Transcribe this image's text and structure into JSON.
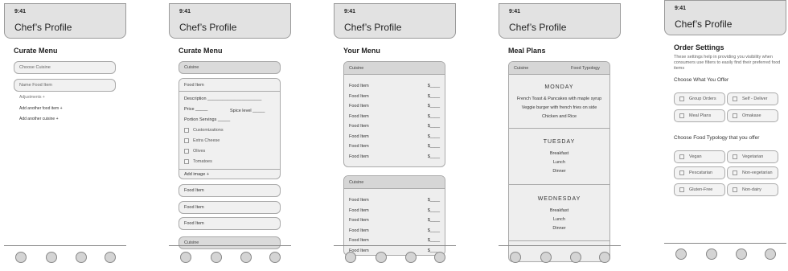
{
  "app": {
    "time": "9:41",
    "title": "Chef’s Profile"
  },
  "screen1": {
    "heading": "Curate Menu",
    "cuisine_placeholder": "Choose Cuisine",
    "food_placeholder": "Name Food Item",
    "adjustments": "Adjustments +",
    "add_food": "Add another food item +",
    "add_cuisine": "Add another cuisine +"
  },
  "screen2": {
    "heading": "Curate Menu",
    "cuisine_label": "Cuisine",
    "food_item_label": "Food Item",
    "description": "Description ______________________",
    "price": "Price _____",
    "spice": "Spice level _____",
    "portion": "Portion Servings _____",
    "options": [
      "Customizations",
      "Extra Cheese",
      "Olives",
      "Tomatoes"
    ],
    "add_image": "Add image +",
    "more_items": [
      "Food Item",
      "Food Item",
      "Food Item"
    ],
    "cuisine_bottom": "Cuisine"
  },
  "screen3": {
    "heading": "Your Menu",
    "card1_head": "Cuisine",
    "card2_head": "Cuisine",
    "item_label": "Food Item",
    "price_label": "$____"
  },
  "screen4": {
    "heading": "Meal Plans",
    "cuisine": "Cuisine",
    "typology": "Food Typology",
    "days": [
      {
        "name": "MONDAY",
        "meals": [
          "French Toast & Pancakes with maple syrup",
          "Veggie burger with french fries on side",
          "Chicken and Rice"
        ]
      },
      {
        "name": "TUESDAY",
        "meals": [
          "Breakfast",
          "Lunch",
          "Dinner"
        ]
      },
      {
        "name": "WEDNESDAY",
        "meals": [
          "Breakfast",
          "Lunch",
          "Dinner"
        ]
      }
    ]
  },
  "screen5": {
    "heading": "Order Settings",
    "description": "These settings help in providing you visibility when consumers use filters to easily find their preferred food items",
    "offer_heading": "Choose What You Offer",
    "offer_options": [
      "Group Orders",
      "Self - Deliver",
      "Meal Plans",
      "Omakase"
    ],
    "typology_heading": "Choose Food Typology that you offer",
    "typology_options": [
      "Vegan",
      "Vegetarian",
      "Pescatarian",
      "Non-vegetarian",
      "Gluten-Free",
      "Non-dairy"
    ]
  }
}
